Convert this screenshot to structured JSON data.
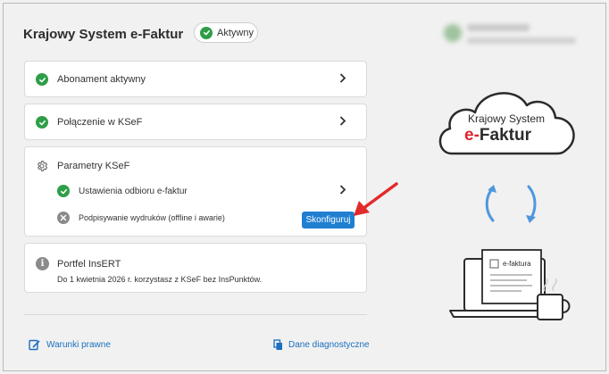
{
  "header": {
    "title": "Krajowy System e-Faktur",
    "status_badge": "Aktywny"
  },
  "cards": {
    "abonament": "Abonament aktywny",
    "polaczenie": "Połączenie w KSeF",
    "parametry": {
      "title": "Parametry KSeF",
      "items": [
        {
          "label": "Ustawienia odbioru e-faktur",
          "status": "ok"
        },
        {
          "label": "Podpisywanie wydruków (offline i awarie)",
          "status": "not-configured",
          "button": "Skonfiguruj"
        }
      ]
    },
    "portfel": {
      "title": "Portfel InsERT",
      "text": "Do 1 kwietnia 2026 r. korzystasz z KSeF bez InsPunktów."
    }
  },
  "footer": {
    "left_link": "Warunki prawne",
    "right_link": "Dane diagnostyczne"
  },
  "illustration": {
    "cloud_line1": "Krajowy System",
    "cloud_line2_prefix": "e-",
    "cloud_line2_suffix": "Faktur",
    "doc_label": "e-faktura"
  },
  "colors": {
    "success": "#2e9e48",
    "accent": "#1f7fd1",
    "arrow": "#e22a2a",
    "brand_red": "#e2232e",
    "neutral_icon": "#8a8a8a"
  }
}
